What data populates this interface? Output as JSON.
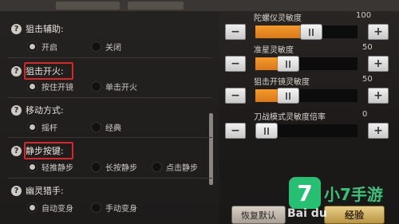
{
  "sections": [
    {
      "title": "狙击辅助:",
      "options": [
        {
          "label": "开启",
          "selected": true
        },
        {
          "label": "关闭",
          "selected": false
        }
      ]
    },
    {
      "title": "狙击开火:",
      "options": [
        {
          "label": "按住开镜",
          "selected": true
        },
        {
          "label": "单击开火",
          "selected": false
        }
      ],
      "highlighted": true
    },
    {
      "title": "移动方式:",
      "options": [
        {
          "label": "摇杆",
          "selected": true
        },
        {
          "label": "经典",
          "selected": false
        }
      ]
    },
    {
      "title": "静步按键:",
      "options": [
        {
          "label": "轻推静步",
          "selected": true
        },
        {
          "label": "长按静步",
          "selected": false
        },
        {
          "label": "点击静步",
          "selected": false
        }
      ],
      "highlighted": true
    },
    {
      "title": "幽灵猎手:",
      "options": [
        {
          "label": "自动变身",
          "selected": true
        },
        {
          "label": "手动变身",
          "selected": false
        }
      ]
    }
  ],
  "sliders": [
    {
      "title": "陀螺仪灵敏度",
      "value": "100",
      "level": 0.55
    },
    {
      "title": "准星灵敏度",
      "value": "50",
      "level": 0.32
    },
    {
      "title": "狙击开镜灵敏度",
      "value": "50",
      "level": 0.32
    },
    {
      "title": "刀战模式灵敏度倍率",
      "value": "0",
      "level": 0.0
    }
  ],
  "minus_label": "−",
  "plus_label": "+",
  "reset_label": "恢复默认",
  "exp_label": "经验",
  "brand_logo": "7",
  "brand_text": "小7手游",
  "watermark": "Bai du",
  "icon_help": "?",
  "colors": {
    "accent": "#e5862a",
    "highlight": "#d8262b",
    "brand": "#27c072"
  }
}
